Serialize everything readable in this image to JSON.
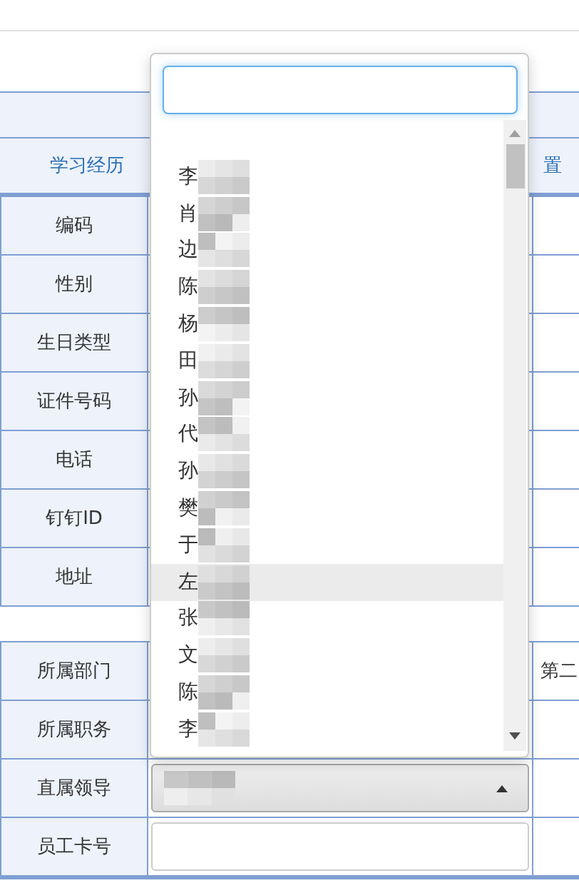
{
  "tabs": [
    {
      "label": "学习经历"
    },
    {
      "label": "置"
    }
  ],
  "upper_rows": [
    {
      "label": "编码"
    },
    {
      "label": "性别"
    },
    {
      "label": "生日类型"
    },
    {
      "label": "证件号码"
    },
    {
      "label": "电话"
    },
    {
      "label": "钉钉ID"
    },
    {
      "label": "地址"
    }
  ],
  "lower_rows": [
    {
      "label": "所属部门",
      "extra": "第二"
    },
    {
      "label": "所属职务"
    },
    {
      "label": "直属领导",
      "kind": "select",
      "open": true
    },
    {
      "label": "员工卡号",
      "kind": "input"
    }
  ],
  "dropdown": {
    "items": [
      {
        "text": "李",
        "highlighted": false
      },
      {
        "text": "肖",
        "highlighted": false
      },
      {
        "text": "边",
        "highlighted": false
      },
      {
        "text": "陈",
        "highlighted": false
      },
      {
        "text": "杨",
        "highlighted": false
      },
      {
        "text": "田",
        "highlighted": false
      },
      {
        "text": "孙",
        "highlighted": false
      },
      {
        "text": "代",
        "highlighted": false
      },
      {
        "text": "孙",
        "highlighted": false
      },
      {
        "text": "樊",
        "highlighted": false
      },
      {
        "text": "于",
        "highlighted": false
      },
      {
        "text": "左",
        "highlighted": true
      },
      {
        "text": "张",
        "highlighted": false
      },
      {
        "text": "文",
        "highlighted": false
      },
      {
        "text": "陈",
        "highlighted": false
      },
      {
        "text": "李",
        "highlighted": false
      }
    ]
  }
}
